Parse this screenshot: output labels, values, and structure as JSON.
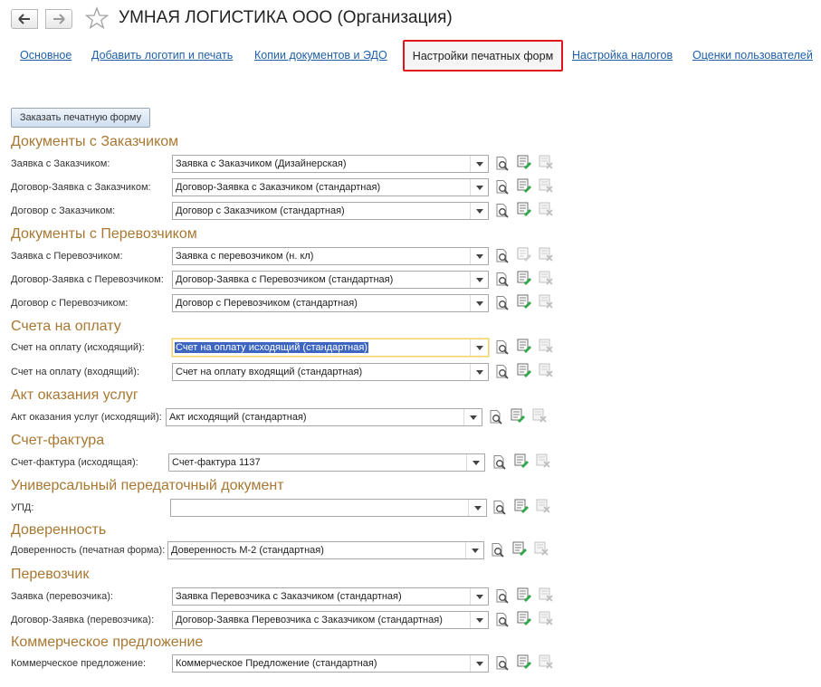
{
  "window": {
    "title": "УМНАЯ ЛОГИСТИКА ООО (Организация)"
  },
  "tabs": [
    {
      "label": "Основное"
    },
    {
      "label": "Добавить логотип и печать"
    },
    {
      "label": "Копии документов и ЭДО"
    },
    {
      "label": "Настройки печатных форм",
      "active": true
    },
    {
      "label": "Настройка налогов"
    },
    {
      "label": "Оценки пользователей"
    }
  ],
  "order_button": {
    "label": "Заказать печатную форму"
  },
  "sections": [
    {
      "title": "Документы с Заказчиком"
    },
    {
      "title": "Документы с Перевозчиком"
    },
    {
      "title": "Счета на оплату"
    },
    {
      "title": "Акт оказания услуг"
    },
    {
      "title": "Счет-фактура"
    },
    {
      "title": "Универсальный передаточный документ"
    },
    {
      "title": "Доверенность"
    },
    {
      "title": "Перевозчик"
    },
    {
      "title": "Коммерческое предложение"
    }
  ],
  "rows": [
    {
      "label": "Заявка с Заказчиком:",
      "value": "Заявка с Заказчиком (Дизайнерская)"
    },
    {
      "label": "Договор-Заявка с Заказчиком:",
      "value": "Договор-Заявка с Заказчиком (стандартная)"
    },
    {
      "label": "Договор с Заказчиком:",
      "value": "Договор с Заказчиком (стандартная)"
    },
    {
      "label": "Заявка с Перевозчиком:",
      "value": "Заявка с перевозчиком (н. кл)"
    },
    {
      "label": "Договор-Заявка с Перевозчиком:",
      "value": "Договор-Заявка с Перевозчиком (стандартная)"
    },
    {
      "label": "Договор с Перевозчиком:",
      "value": "Договор с Перевозчиком (стандартная)"
    },
    {
      "label": "Счет на оплату (исходящий):",
      "value": "Счет на оплату исходящий (стандартная)",
      "focused": true
    },
    {
      "label": "Счет на оплату (входящий):",
      "value": "Счет на оплату входящий (стандартная)"
    },
    {
      "label": "Акт оказания услуг (исходящий):",
      "value": "Акт исходящий (стандартная)"
    },
    {
      "label": "Счет-фактура (исходящая):",
      "value": "Счет-фактура 1137"
    },
    {
      "label": "УПД:",
      "value": ""
    },
    {
      "label": "Доверенность (печатная форма):",
      "value": "Доверенность М-2 (стандартная)"
    },
    {
      "label": "Заявка (перевозчика):",
      "value": "Заявка Перевозчика с Заказчиком (стандартная)"
    },
    {
      "label": "Договор-Заявка (перевозчика):",
      "value": "Договор-Заявка Перевозчика с Заказчиком (стандартная)"
    },
    {
      "label": "Коммерческое предложение:",
      "value": "Коммерческое Предложение (стандартная)"
    }
  ],
  "icons": {
    "back": "arrow-left-icon",
    "forward": "arrow-right-icon",
    "favorite": "star-icon",
    "dropdown": "chevron-down-icon",
    "preview": "magnifier-document-icon",
    "edit": "edit-document-icon",
    "delete": "delete-document-icon"
  },
  "colors": {
    "section_title": "#a87832",
    "tab_link": "#1f5fa8",
    "active_tab_outline": "#e3131c",
    "selection": "#3d66c3"
  }
}
